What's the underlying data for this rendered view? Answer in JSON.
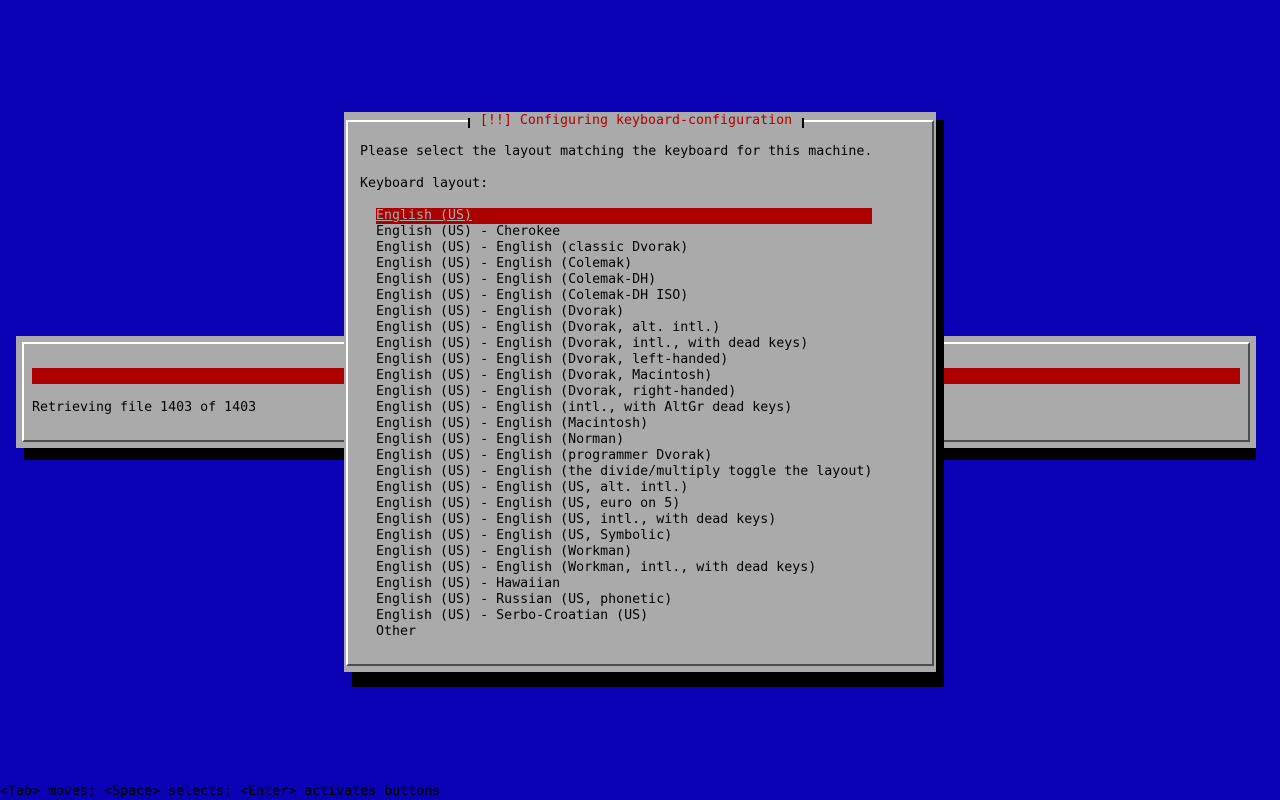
{
  "progress": {
    "status_text": "Retrieving file 1403 of 1403",
    "fraction": 1.0,
    "colors": {
      "fill": "#aa0000",
      "track": "#0a00b4"
    }
  },
  "dialog": {
    "title": "[!!] Configuring keyboard-configuration",
    "question": "Please select the layout matching the keyboard for this machine.",
    "list_label": "Keyboard layout:",
    "selected_index": 0,
    "options": [
      "English (US)",
      "English (US) - Cherokee",
      "English (US) - English (classic Dvorak)",
      "English (US) - English (Colemak)",
      "English (US) - English (Colemak-DH)",
      "English (US) - English (Colemak-DH ISO)",
      "English (US) - English (Dvorak)",
      "English (US) - English (Dvorak, alt. intl.)",
      "English (US) - English (Dvorak, intl., with dead keys)",
      "English (US) - English (Dvorak, left-handed)",
      "English (US) - English (Dvorak, Macintosh)",
      "English (US) - English (Dvorak, right-handed)",
      "English (US) - English (intl., with AltGr dead keys)",
      "English (US) - English (Macintosh)",
      "English (US) - English (Norman)",
      "English (US) - English (programmer Dvorak)",
      "English (US) - English (the divide/multiply toggle the layout)",
      "English (US) - English (US, alt. intl.)",
      "English (US) - English (US, euro on 5)",
      "English (US) - English (US, intl., with dead keys)",
      "English (US) - English (US, Symbolic)",
      "English (US) - English (Workman)",
      "English (US) - English (Workman, intl., with dead keys)",
      "English (US) - Hawaiian",
      "English (US) - Russian (US, phonetic)",
      "English (US) - Serbo-Croatian (US)",
      "Other"
    ]
  },
  "help_line": "<Tab> moves; <Space> selects; <Enter> activates buttons",
  "colors": {
    "background": "#0a00b4",
    "dialog": "#aaaaaa",
    "title": "#aa0000",
    "selection": "#aa0000"
  }
}
